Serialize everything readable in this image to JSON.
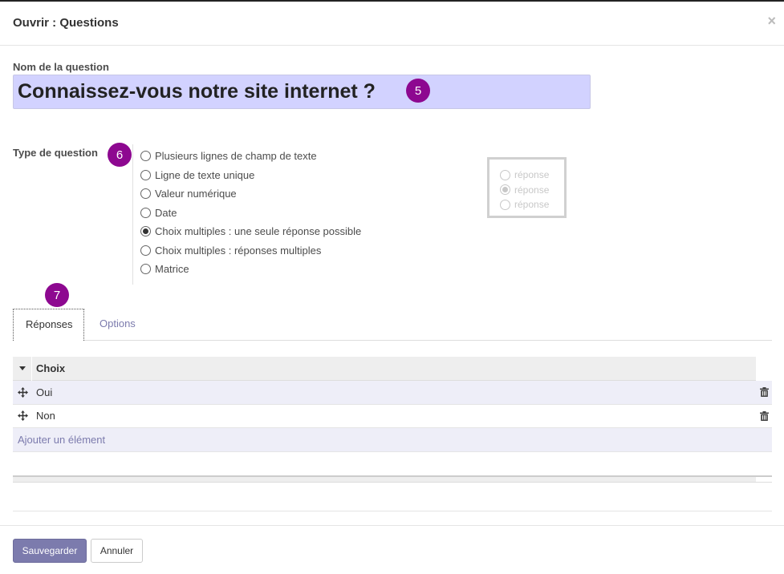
{
  "dialog": {
    "title": "Ouvrir : Questions",
    "close": "×"
  },
  "question_name": {
    "label": "Nom de la question",
    "value": "Connaissez-vous notre site internet ?"
  },
  "question_type": {
    "label": "Type de question",
    "options": [
      {
        "label": "Plusieurs lignes de champ de texte",
        "checked": false
      },
      {
        "label": "Ligne de texte unique",
        "checked": false
      },
      {
        "label": "Valeur numérique",
        "checked": false
      },
      {
        "label": "Date",
        "checked": false
      },
      {
        "label": "Choix multiples : une seule réponse possible",
        "checked": true
      },
      {
        "label": "Choix multiples : réponses multiples",
        "checked": false
      },
      {
        "label": "Matrice",
        "checked": false
      }
    ],
    "preview": [
      "réponse",
      "réponse",
      "réponse"
    ]
  },
  "badges": [
    "5",
    "6",
    "7"
  ],
  "tabs": [
    {
      "label": "Réponses",
      "active": true
    },
    {
      "label": "Options",
      "active": false
    }
  ],
  "answers_table": {
    "column": "Choix",
    "rows": [
      "Oui",
      "Non"
    ],
    "add_item": "Ajouter un élément"
  },
  "footer": {
    "save": "Sauvegarder",
    "cancel": "Annuler"
  },
  "colors": {
    "accent": "#7c7bad",
    "badge": "#8d0890",
    "name_field_bg": "#d2d2ff"
  }
}
